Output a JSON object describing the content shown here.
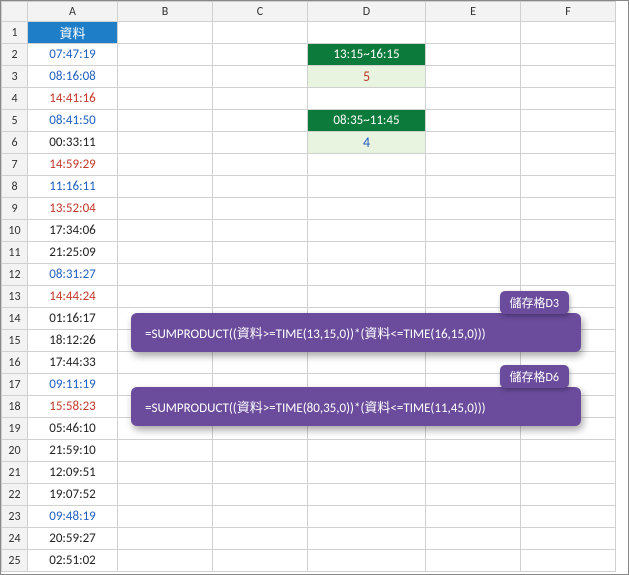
{
  "columns": [
    "A",
    "B",
    "C",
    "D",
    "E",
    "F"
  ],
  "rows": [
    {
      "n": 1,
      "A": {
        "t": "資料",
        "cls": "hdr-cell"
      }
    },
    {
      "n": 2,
      "A": {
        "t": "07:47:19",
        "cls": "time-blue"
      },
      "D": {
        "t": "13:15~16:15",
        "cls": "range-cell"
      }
    },
    {
      "n": 3,
      "A": {
        "t": "08:16:08",
        "cls": "time-blue"
      },
      "D": {
        "t": "5",
        "cls": "result-cell"
      }
    },
    {
      "n": 4,
      "A": {
        "t": "14:41:16",
        "cls": "time-red"
      }
    },
    {
      "n": 5,
      "A": {
        "t": "08:41:50",
        "cls": "time-blue"
      },
      "D": {
        "t": "08:35~11:45",
        "cls": "range-cell"
      }
    },
    {
      "n": 6,
      "A": {
        "t": "00:33:11",
        "cls": "time-black"
      },
      "D": {
        "t": "4",
        "cls": "result-cell blue"
      }
    },
    {
      "n": 7,
      "A": {
        "t": "14:59:29",
        "cls": "time-red"
      }
    },
    {
      "n": 8,
      "A": {
        "t": "11:16:11",
        "cls": "time-blue"
      }
    },
    {
      "n": 9,
      "A": {
        "t": "13:52:04",
        "cls": "time-red"
      }
    },
    {
      "n": 10,
      "A": {
        "t": "17:34:06",
        "cls": "time-black"
      }
    },
    {
      "n": 11,
      "A": {
        "t": "21:25:09",
        "cls": "time-black"
      }
    },
    {
      "n": 12,
      "A": {
        "t": "08:31:27",
        "cls": "time-blue"
      }
    },
    {
      "n": 13,
      "A": {
        "t": "14:44:24",
        "cls": "time-red"
      }
    },
    {
      "n": 14,
      "A": {
        "t": "01:16:17",
        "cls": "time-black"
      }
    },
    {
      "n": 15,
      "A": {
        "t": "18:12:26",
        "cls": "time-black"
      }
    },
    {
      "n": 16,
      "A": {
        "t": "17:44:33",
        "cls": "time-black"
      }
    },
    {
      "n": 17,
      "A": {
        "t": "09:11:19",
        "cls": "time-blue"
      }
    },
    {
      "n": 18,
      "A": {
        "t": "15:58:23",
        "cls": "time-red"
      }
    },
    {
      "n": 19,
      "A": {
        "t": "05:46:10",
        "cls": "time-black"
      }
    },
    {
      "n": 20,
      "A": {
        "t": "21:59:10",
        "cls": "time-black"
      }
    },
    {
      "n": 21,
      "A": {
        "t": "12:09:51",
        "cls": "time-black"
      }
    },
    {
      "n": 22,
      "A": {
        "t": "19:07:52",
        "cls": "time-black"
      }
    },
    {
      "n": 23,
      "A": {
        "t": "09:48:19",
        "cls": "time-blue"
      }
    },
    {
      "n": 24,
      "A": {
        "t": "20:59:27",
        "cls": "time-black"
      }
    },
    {
      "n": 25,
      "A": {
        "t": "02:51:02",
        "cls": "time-black"
      }
    }
  ],
  "callouts": {
    "a": {
      "tag": "儲存格D3",
      "formula": "=SUMPRODUCT((資料>=TIME(13,15,0))*(資料<=TIME(16,15,0)))"
    },
    "b": {
      "tag": "儲存格D6",
      "formula": "=SUMPRODUCT((資料>=TIME(80,35,0))*(資料<=TIME(11,45,0)))"
    }
  }
}
